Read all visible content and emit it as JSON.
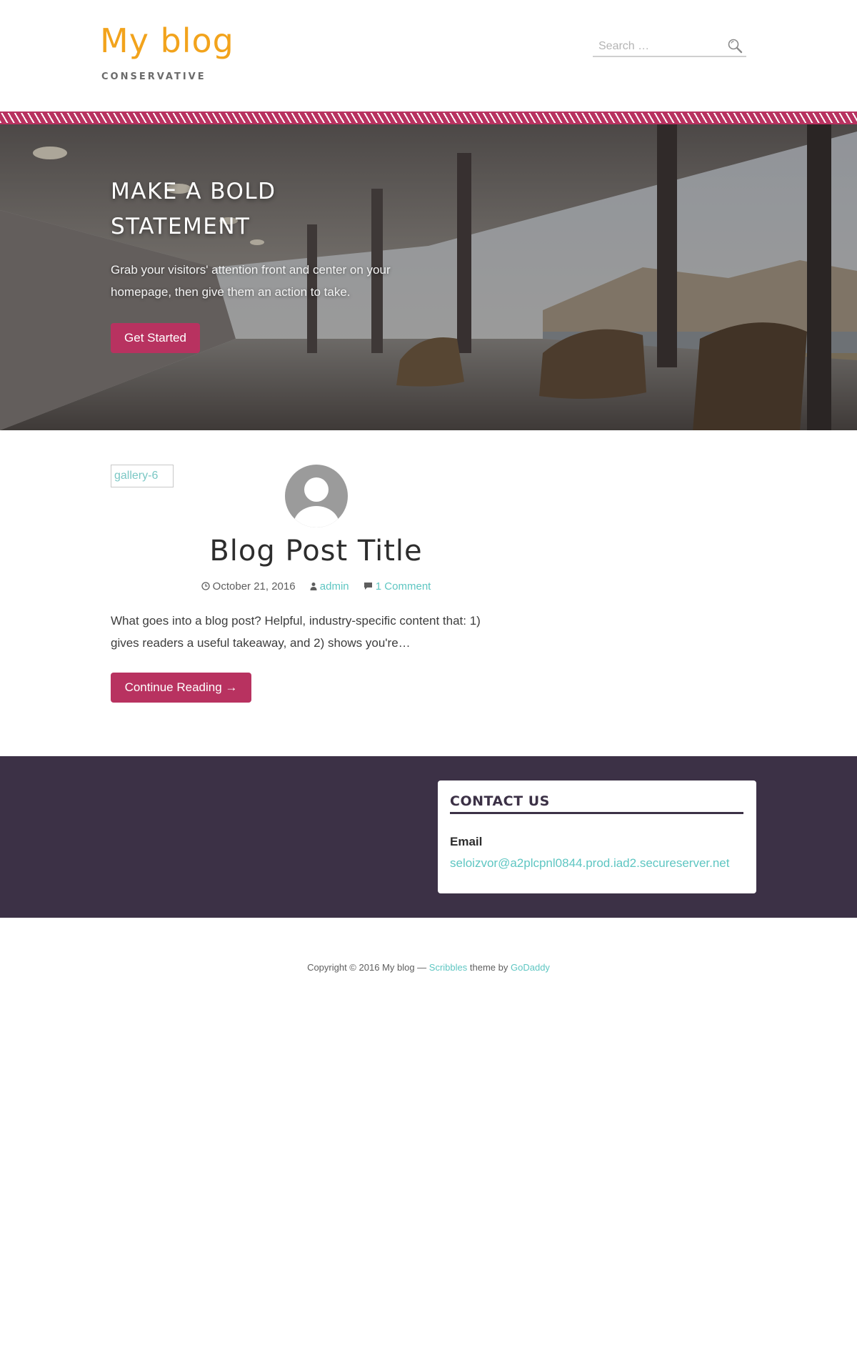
{
  "header": {
    "site_title": "My blog",
    "site_description": "CONSERVATIVE",
    "search": {
      "placeholder": "Search …"
    }
  },
  "colors": {
    "accent": "#b83260",
    "link": "#5ec6c2",
    "title": "#f2a31c",
    "footer_bg": "#3c3146"
  },
  "hero": {
    "title": "MAKE A BOLD STATEMENT",
    "text": "Grab your visitors' attention front and center on your homepage, then give them an action to take.",
    "button_label": "Get Started"
  },
  "post": {
    "thumbnail_alt": "gallery-6",
    "title": "Blog Post Title",
    "date": "October 21, 2016",
    "author": "admin",
    "comments": "1 Comment",
    "excerpt": "What goes into a blog post? Helpful, industry-specific content that: 1) gives readers a useful takeaway, and 2) shows you're…",
    "continue_label": "Continue Reading →"
  },
  "footer_widget": {
    "title": "CONTACT US",
    "email_label": "Email",
    "email": "seloizvor@a2plcpnl0844.prod.iad2.secureserver.net"
  },
  "site_info": {
    "prefix": "Copyright © 2016 My blog —",
    "theme_name": "Scribbles",
    "middle": "theme by",
    "author_name": "GoDaddy"
  },
  "icons": {
    "search": "search-icon",
    "clock": "clock-icon",
    "user": "user-icon",
    "comment": "comment-icon",
    "avatar": "avatar-icon"
  }
}
